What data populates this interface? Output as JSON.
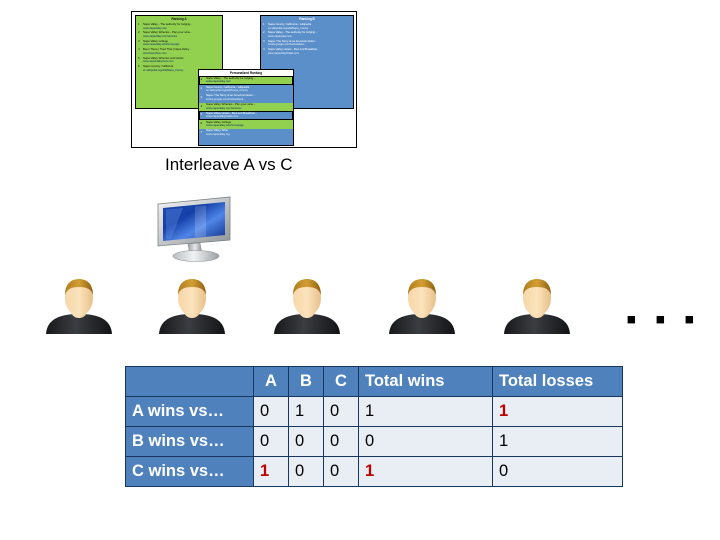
{
  "caption": "Interleave A vs C",
  "ellipsis": "▪ ▪ ▪",
  "colors": {
    "header_blue": "#4F81BD",
    "cell_light": "#E9EDF4",
    "ranking_a_green": "#92D050",
    "ranking_b_blue": "#5B8FC9",
    "highlight_red": "#C00000",
    "border_navy": "#17375E"
  },
  "figure": {
    "ranking_a": {
      "title": "Ranking A",
      "items": [
        {
          "num": "1",
          "text": "Napa Valley - The authority for lodging...",
          "url": "www.napavalley.com"
        },
        {
          "num": "2",
          "text": "Napa Valley Wineries - Plan your wine...",
          "url": "www.napavalley.com/wineries"
        },
        {
          "num": "3",
          "text": "Napa Valley College",
          "url": "www.napavalley.edu/homepage"
        },
        {
          "num": "4",
          "text": "Been There | Tried That | Napa Valley",
          "url": "www.beenthere.com"
        },
        {
          "num": "5",
          "text": "Napa Valley Wineries and Hotels",
          "url": "www.napelvalleytours.com"
        },
        {
          "num": "6",
          "text": "Napa Country, California",
          "url": "en.wikipedia.org/wiki/Napa_County"
        }
      ]
    },
    "ranking_b": {
      "title": "Ranking B",
      "items": [
        {
          "num": "1",
          "text": "Napa County, California - wikipedia",
          "url": "en.wikipedia.org/wiki/Napa_County"
        },
        {
          "num": "2",
          "text": "Napa Valley - The authority for lodging...",
          "url": "www.napavalley.com"
        },
        {
          "num": "3",
          "text": "Napa: The Story of an American Eden...",
          "url": "books.google.com/books/about..."
        },
        {
          "num": "4",
          "text": "Napa Valley Hotels - Bed and Breakfast...",
          "url": "www.napavalleyhotels.com"
        }
      ]
    },
    "interleaved": {
      "title": "Personalized Ranking",
      "items": [
        {
          "num": "1",
          "text": "Napa Valley - The authority for lodging...",
          "url": "www.napavalley.com",
          "source": "a",
          "highlight": true
        },
        {
          "num": "2",
          "text": "Napa County, California - wikipedia",
          "url": "en.wikipedia.org/wiki/Napa_County",
          "source": "b",
          "highlight": false
        },
        {
          "num": "3",
          "text": "Napa: The Story of an American Eden...",
          "url": "books.google.com/books/about...",
          "source": "b",
          "highlight": false
        },
        {
          "num": "4",
          "text": "Napa Valley Wineries - Plan your wine...",
          "url": "www.napavalley.com/wineries",
          "source": "a",
          "highlight": false
        },
        {
          "num": "5",
          "text": "Napa Valley Hotels - Bed and Breakfast...",
          "url": "www.napavalleyhotels.com",
          "source": "b",
          "highlight": true
        },
        {
          "num": "6",
          "text": "Napa Valley College",
          "url": "www.napavalley.edu/homepage",
          "source": "a",
          "highlight": false
        },
        {
          "num": "7",
          "text": "Napa Valley Wine",
          "url": "www.napavalley.org",
          "source": "b",
          "highlight": false
        }
      ]
    }
  },
  "avatars": {
    "count": 5,
    "label": "user-avatar"
  },
  "table": {
    "columns": [
      "",
      "A",
      "B",
      "C",
      "Total wins",
      "Total losses"
    ],
    "rows": [
      {
        "label": "A wins vs…",
        "cells": [
          {
            "value": "0",
            "red": false
          },
          {
            "value": "1",
            "red": false
          },
          {
            "value": "0",
            "red": false
          },
          {
            "value": "1",
            "red": false
          },
          {
            "value": "1",
            "red": true
          }
        ]
      },
      {
        "label": "B wins vs…",
        "cells": [
          {
            "value": "0",
            "red": false
          },
          {
            "value": "0",
            "red": false
          },
          {
            "value": "0",
            "red": false
          },
          {
            "value": "0",
            "red": false
          },
          {
            "value": "1",
            "red": false
          }
        ]
      },
      {
        "label": "C wins vs…",
        "cells": [
          {
            "value": "1",
            "red": true
          },
          {
            "value": "0",
            "red": false
          },
          {
            "value": "0",
            "red": false
          },
          {
            "value": "1",
            "red": true
          },
          {
            "value": "0",
            "red": false
          }
        ]
      }
    ]
  }
}
